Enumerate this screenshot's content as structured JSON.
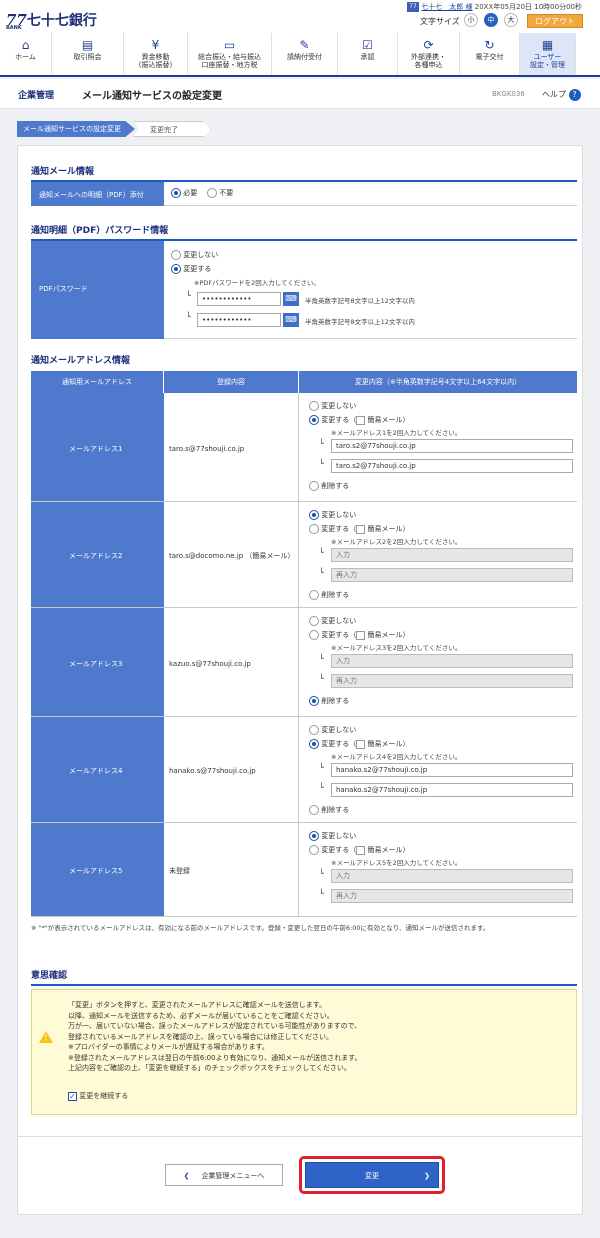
{
  "brand": {
    "mark": "77",
    "sub": "BANK",
    "name": "七十七銀行"
  },
  "header": {
    "user": "七十七　太郎 様",
    "timestamp": "20XX年05月20日 10時00分00秒",
    "font_size_label": "文字サイズ",
    "font_small": "小",
    "font_mid": "中",
    "font_large": "大",
    "logout": "ログアウト"
  },
  "nav": [
    {
      "icon": "home-icon",
      "label": "ホーム"
    },
    {
      "icon": "document-icon",
      "label": "取引照会"
    },
    {
      "icon": "yen-icon",
      "label": "資金移動\n(振込振替)"
    },
    {
      "icon": "card-icon",
      "label": "総合振込・給与振込\n口座振替・地方税"
    },
    {
      "icon": "edit-icon",
      "label": "請納付受付"
    },
    {
      "icon": "approval-icon",
      "label": "承認"
    },
    {
      "icon": "link-icon",
      "label": "外部連携・\n各種申込"
    },
    {
      "icon": "cycle-icon",
      "label": "電子交付"
    },
    {
      "icon": "user-admin-icon",
      "label": "ユーザー\n設定・管理"
    }
  ],
  "page": {
    "section": "企業管理",
    "title": "メール通知サービスの設定変更",
    "code": "BKGK036",
    "help": "ヘルプ"
  },
  "breadcrumb": [
    "メール通知サービスの設定変更",
    "変更完了"
  ],
  "notify": {
    "heading": "通知メール情報",
    "label": "通知メールへの明細（PDF）添付",
    "opt_yes": "必要",
    "opt_no": "不要"
  },
  "pdf": {
    "heading": "通知明細（PDF）パスワード情報",
    "label": "PDFパスワード",
    "opt_nochange": "変更しない",
    "opt_change": "変更する",
    "note": "※PDFパスワードを2回入力してください。",
    "pw1": "••••••••••••",
    "pw2": "••••••••••••",
    "hint1": "半角英数字記号8文字以上12文字以内",
    "hint2": "半角英数字記号8文字以上12文字以内"
  },
  "addr": {
    "heading": "通知メールアドレス情報",
    "col1": "通知用メールアドレス",
    "col2": "登録内容",
    "col3": "変更内容（※半角英数字記号4文字以上64文字以内）",
    "rows": [
      {
        "label": "メールアドレス1",
        "current": "taro.s@77shouji.co.jp",
        "opt_nochange": "変更しない",
        "opt_change": "変更する（",
        "easy": "簡易メール）",
        "note": "※メールアドレス1を2回入力してください。",
        "v1": "taro.s2@77shouji.co.jp",
        "v2": "taro.s2@77shouji.co.jp",
        "opt_delete": "削除する",
        "sel": "change"
      },
      {
        "label": "メールアドレス2",
        "current": "taro.s@docomo.ne.jp （簡易メール）",
        "opt_nochange": "変更しない",
        "opt_change": "変更する（",
        "easy": "簡易メール）",
        "note": "※メールアドレス2を2回入力してください。",
        "v1": "入力",
        "v2": "再入力",
        "opt_delete": "削除する",
        "sel": "nochange"
      },
      {
        "label": "メールアドレス3",
        "current": "kazuo.s@77shouji.co.jp",
        "opt_nochange": "変更しない",
        "opt_change": "変更する（",
        "easy": "簡易メール）",
        "note": "※メールアドレス3を2回入力してください。",
        "v1": "入力",
        "v2": "再入力",
        "opt_delete": "削除する",
        "sel": "delete"
      },
      {
        "label": "メールアドレス4",
        "current": "hanako.s@77shouji.co.jp",
        "opt_nochange": "変更しない",
        "opt_change": "変更する（",
        "easy": "簡易メール）",
        "note": "※メールアドレス4を2回入力してください。",
        "v1": "hanako.s2@77shouji.co.jp",
        "v2": "hanako.s2@77shouji.co.jp",
        "opt_delete": "削除する",
        "sel": "change"
      },
      {
        "label": "メールアドレス5",
        "current": "未登録",
        "opt_nochange": "変更しない",
        "opt_change": "変更する（",
        "easy": "簡易メール）",
        "note": "※メールアドレス5を2回入力してください。",
        "v1": "入力",
        "v2": "再入力",
        "opt_delete": "",
        "sel": "nochange"
      }
    ],
    "footnote": "※ \"*\"が表示されているメールアドレスは、有効になる前のメールアドレスです。登録・変更した翌日の午前6:00に有効となり、通知メールが送信されます。"
  },
  "confirm": {
    "heading": "意思確認",
    "lines": [
      "「変更」ボタンを押すと、変更されたメールアドレスに確認メールを送信します。",
      "以降、通知メールを送信するため、必ずメールが届いていることをご確認ください。",
      "万が一、届いていない場合、誤ったメールアドレスが設定されている可能性がありますので、",
      "登録されているメールアドレスを確認の上、誤っている場合には修正してください。",
      "※プロバイダーの事情によりメールが遅延する場合があります。",
      "※登録されたメールアドレスは翌日の午前6:00より有効になり、通知メールが送信されます。",
      "上記内容をご確認の上、「変更を継続する」のチェックボックスをチェックしてください。"
    ],
    "checkbox": "変更を継続する"
  },
  "actions": {
    "back": "企業管理メニューへ",
    "submit": "変更"
  },
  "colors": {
    "navy": "#1d3f9a",
    "label_bg": "#4e79cc",
    "accent": "#f0a73b",
    "highlight": "#e0202a"
  }
}
